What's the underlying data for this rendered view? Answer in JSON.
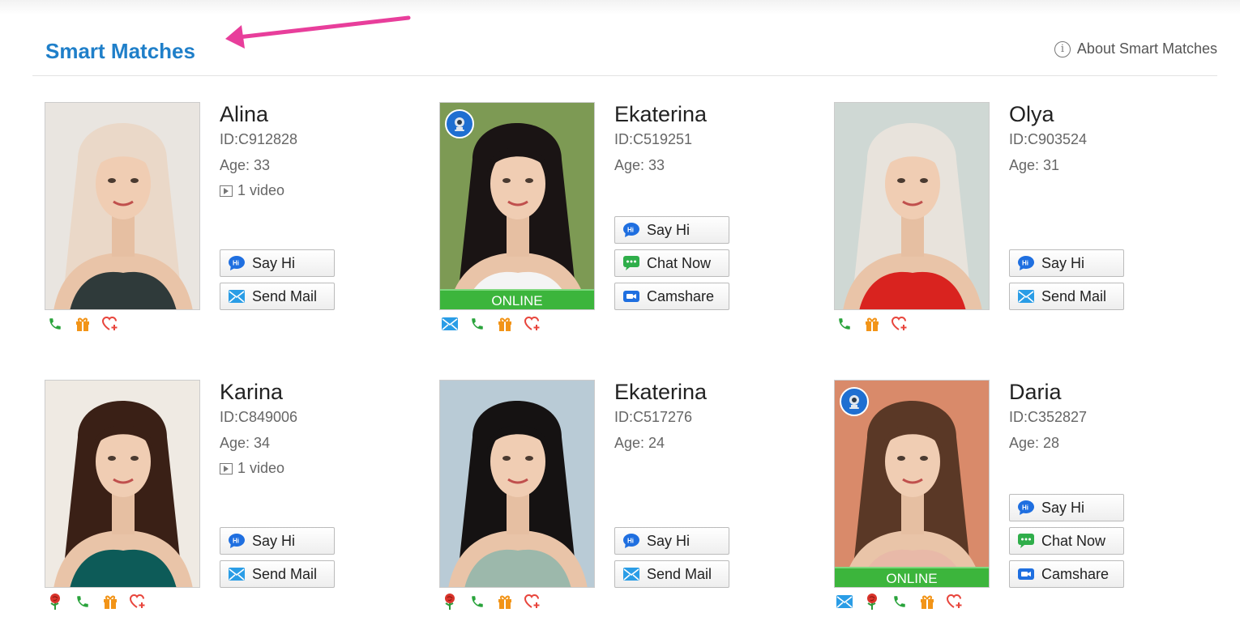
{
  "header": {
    "title": "Smart Matches",
    "about_label": "About Smart Matches"
  },
  "colors": {
    "title_blue": "#1f7fc9",
    "online_green": "#3cb53c",
    "arrow_pink": "#e83e9b"
  },
  "profiles": [
    {
      "name": "Alina",
      "id": "ID:C912828",
      "age": "Age: 33",
      "video": "1 video",
      "online": false,
      "buttons": [
        "Say Hi",
        "Send Mail"
      ],
      "icons": [
        "phone-icon",
        "gift-icon",
        "heart-plus-icon"
      ],
      "hair": "#ead8c8",
      "bg": "#e9e5e0",
      "cloth": "#2f3a3a"
    },
    {
      "name": "Ekaterina",
      "id": "ID:C519251",
      "age": "Age: 33",
      "video": "",
      "online": true,
      "online_label": "ONLINE",
      "buttons": [
        "Say Hi",
        "Chat Now",
        "Camshare"
      ],
      "icons": [
        "mail-icon",
        "phone-icon",
        "gift-icon",
        "heart-plus-icon"
      ],
      "hair": "#1a1414",
      "bg": "#7d9a54",
      "cloth": "#f4f4f4"
    },
    {
      "name": "Olya",
      "id": "ID:C903524",
      "age": "Age: 31",
      "video": "",
      "online": false,
      "buttons": [
        "Say Hi",
        "Send Mail"
      ],
      "icons": [
        "phone-icon",
        "gift-icon",
        "heart-plus-icon"
      ],
      "hair": "#e8e3dc",
      "bg": "#cfd8d4",
      "cloth": "#d9231f"
    },
    {
      "name": "Karina",
      "id": "ID:C849006",
      "age": "Age: 34",
      "video": "1 video",
      "online": false,
      "buttons": [
        "Say Hi",
        "Send Mail"
      ],
      "icons": [
        "rose-icon",
        "phone-icon",
        "gift-icon",
        "heart-plus-icon"
      ],
      "hair": "#3a2016",
      "bg": "#efeae3",
      "cloth": "#0d5b58"
    },
    {
      "name": "Ekaterina",
      "id": "ID:C517276",
      "age": "Age: 24",
      "video": "",
      "online": false,
      "buttons": [
        "Say Hi",
        "Send Mail"
      ],
      "icons": [
        "rose-icon",
        "phone-icon",
        "gift-icon",
        "heart-plus-icon"
      ],
      "hair": "#151212",
      "bg": "#b9cbd6",
      "cloth": "#9cb8ab"
    },
    {
      "name": "Daria",
      "id": "ID:C352827",
      "age": "Age: 28",
      "video": "",
      "online": true,
      "online_label": "ONLINE",
      "buttons": [
        "Say Hi",
        "Chat Now",
        "Camshare"
      ],
      "icons": [
        "mail-icon",
        "rose-icon",
        "phone-icon",
        "gift-icon",
        "heart-plus-icon"
      ],
      "hair": "#5a3826",
      "bg": "#d98a6a",
      "cloth": "#e8b9a8"
    }
  ]
}
